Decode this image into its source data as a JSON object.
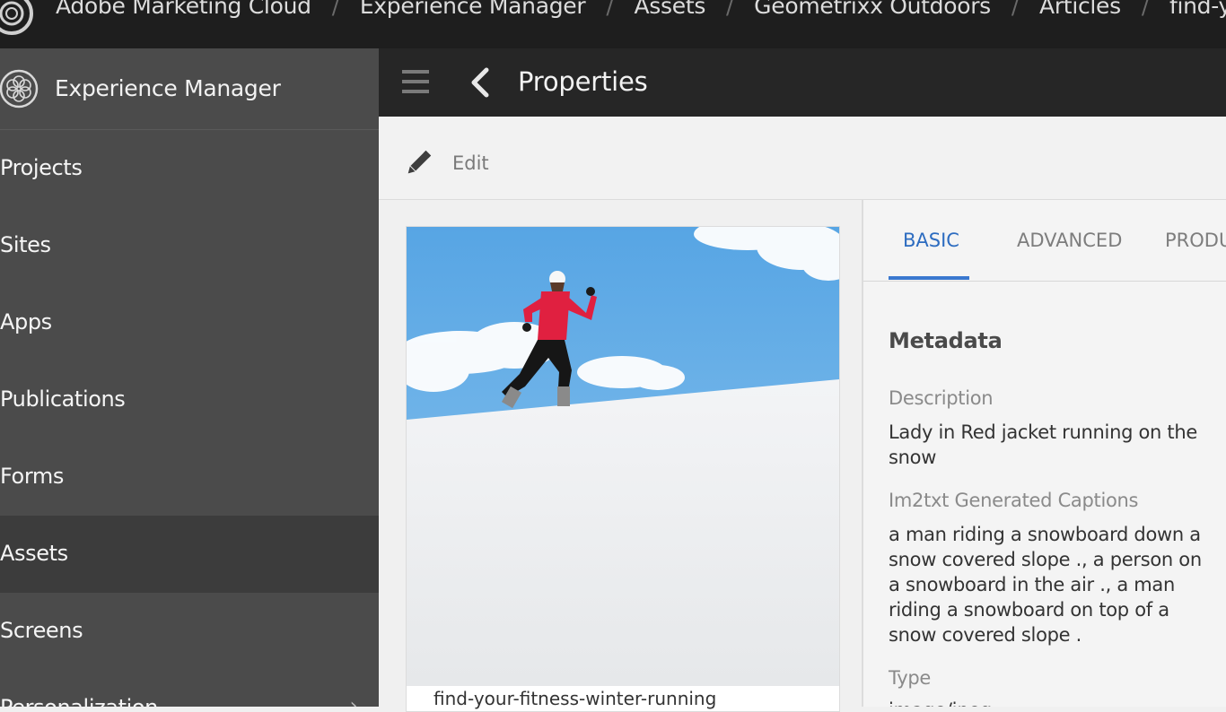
{
  "topbar": {
    "breadcrumbs": [
      "Adobe Marketing Cloud",
      "Experience Manager",
      "Assets",
      "Geometrixx Outdoors",
      "Articles",
      "find-your-fitness"
    ],
    "separator": "/"
  },
  "rail": {
    "title": "Experience Manager",
    "items": [
      {
        "label": "Projects"
      },
      {
        "label": "Sites"
      },
      {
        "label": "Apps"
      },
      {
        "label": "Publications"
      },
      {
        "label": "Forms"
      },
      {
        "label": "Assets",
        "active": true
      },
      {
        "label": "Screens"
      },
      {
        "label": "Personalization"
      }
    ]
  },
  "header": {
    "title": "Properties",
    "menu_icon": "hamburger-icon",
    "back_icon": "chevron-left-icon"
  },
  "toolbar": {
    "edit_label": "Edit",
    "edit_icon": "pencil-icon"
  },
  "asset": {
    "image": "runner-in-red-jacket-on-snow",
    "caption": "find-your-fitness-winter-running"
  },
  "tabs": [
    {
      "label": "BASIC",
      "active": true
    },
    {
      "label": "ADVANCED"
    },
    {
      "label": "PRODUCT"
    }
  ],
  "metadata": {
    "heading": "Metadata",
    "fields": [
      {
        "label": "Description",
        "value": "Lady in Red jacket running on the snow"
      },
      {
        "label": "Im2txt Generated Captions",
        "value": "a man riding a snowboard down a snow covered slope ., a person on a snowboard in the air ., a man riding a snowboard on top of a snow covered slope ."
      },
      {
        "label": "Type",
        "value": "image/jpeg"
      }
    ]
  },
  "colors": {
    "accent": "#2d6cc0",
    "rail_bg": "#4b4b4b",
    "topbar_bg": "#1e1e1e"
  }
}
